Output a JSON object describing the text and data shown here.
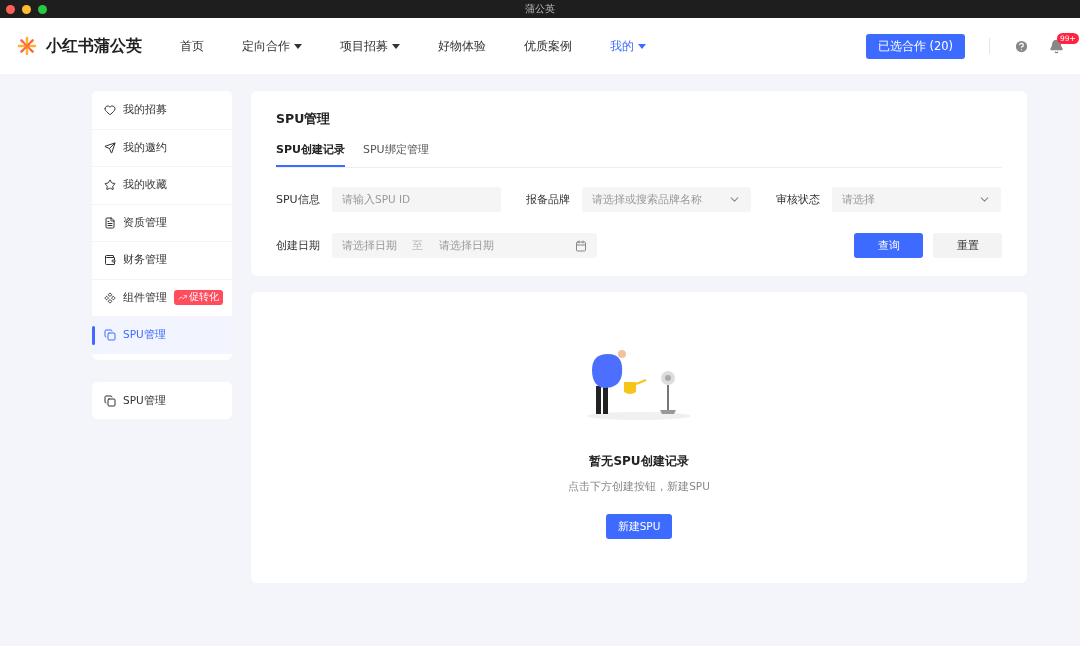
{
  "window": {
    "title": "蒲公英"
  },
  "header": {
    "logo": "小红书蒲公英",
    "nav": [
      {
        "label": "首页",
        "dropdown": false,
        "selected": false
      },
      {
        "label": "定向合作",
        "dropdown": true,
        "selected": false
      },
      {
        "label": "项目招募",
        "dropdown": true,
        "selected": false
      },
      {
        "label": "好物体验",
        "dropdown": false,
        "selected": false
      },
      {
        "label": "优质案例",
        "dropdown": false,
        "selected": false
      },
      {
        "label": "我的",
        "dropdown": true,
        "selected": true
      }
    ],
    "cart_button": "已选合作 (20)",
    "notification_badge": "99+"
  },
  "sidebar": {
    "items": [
      {
        "kind": "heart",
        "label": "我的招募",
        "selected": false
      },
      {
        "kind": "send",
        "label": "我的邀约",
        "selected": false
      },
      {
        "kind": "star",
        "label": "我的收藏",
        "selected": false
      },
      {
        "kind": "doc",
        "label": "资质管理",
        "selected": false
      },
      {
        "kind": "wallet",
        "label": "财务管理",
        "selected": false
      },
      {
        "kind": "component",
        "label": "组件管理",
        "selected": false,
        "tag": "促转化"
      },
      {
        "kind": "copy",
        "label": "SPU管理",
        "selected": true
      }
    ],
    "extra_items": [
      {
        "kind": "copy",
        "label": "SPU管理",
        "selected": false
      }
    ]
  },
  "main": {
    "title": "SPU管理",
    "tabs": [
      {
        "label": "SPU创建记录",
        "selected": true
      },
      {
        "label": "SPU绑定管理",
        "selected": false
      }
    ],
    "filters": [
      {
        "kind": "input",
        "label": "SPU信息",
        "placeholder": "请输入SPU ID"
      },
      {
        "kind": "select",
        "label": "报备品牌",
        "placeholder": "请选择或搜索品牌名称"
      },
      {
        "kind": "select",
        "label": "审核状态",
        "placeholder": "请选择"
      }
    ],
    "date_filter": {
      "label": "创建日期",
      "start_placeholder": "请选择日期",
      "separator": "至",
      "end_placeholder": "请选择日期"
    },
    "buttons": [
      {
        "kind": "primary",
        "label": "查询"
      },
      {
        "kind": "secondary",
        "label": "重置"
      }
    ]
  },
  "empty_state": {
    "title": "暂无SPU创建记录",
    "hint": "点击下方创建按钮，新建SPU",
    "button": "新建SPU"
  }
}
